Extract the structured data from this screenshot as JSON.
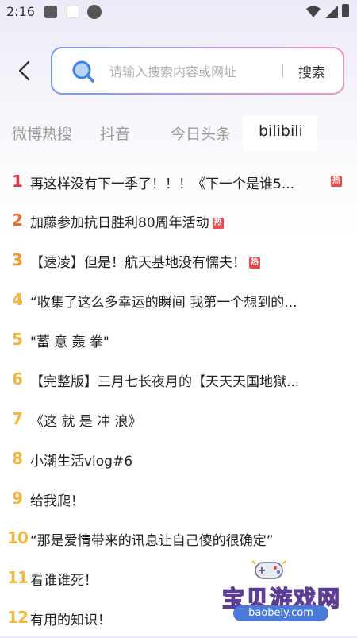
{
  "status_bar": {
    "time": "2:16"
  },
  "header": {
    "search_placeholder": "请输入搜索内容或网址",
    "search_button": "搜索"
  },
  "tabs": [
    {
      "label": "微博热搜",
      "active": false
    },
    {
      "label": "抖音",
      "active": false
    },
    {
      "label": "今日头条",
      "active": false
    },
    {
      "label": "bilibili",
      "active": true
    }
  ],
  "hot_list": [
    {
      "rank": "1",
      "title": "再这样没有下一季了！！！《下一个是谁5...",
      "badge": "热",
      "rank_color": "#e0393e"
    },
    {
      "rank": "2",
      "title": "加藤参加抗日胜利80周年活动",
      "badge": "热",
      "rank_color": "#ee6a2f"
    },
    {
      "rank": "3",
      "title": "【速凌】但是！航天基地没有懦夫！",
      "badge": "热",
      "rank_color": "#f09a2b"
    },
    {
      "rank": "4",
      "title": "“收集了这么多幸运的瞬间 我第一个想到的...",
      "badge": "",
      "rank_color": "#f4b63a"
    },
    {
      "rank": "5",
      "title": "\"蓄 意 轰 拳\"",
      "badge": "",
      "rank_color": "#f4b63a"
    },
    {
      "rank": "6",
      "title": "【完整版】三月七长夜月的【天天天国地獄...",
      "badge": "",
      "rank_color": "#f4b63a"
    },
    {
      "rank": "7",
      "title": "《这 就 是 冲 浪》",
      "badge": "",
      "rank_color": "#f4b63a"
    },
    {
      "rank": "8",
      "title": "小潮生活vlog#6",
      "badge": "",
      "rank_color": "#f4b63a"
    },
    {
      "rank": "9",
      "title": "给我爬！",
      "badge": "",
      "rank_color": "#f4b63a"
    },
    {
      "rank": "10",
      "title": "“那是爱情带来的讯息让自己傻的很确定”",
      "badge": "",
      "rank_color": "#f4b63a"
    },
    {
      "rank": "11",
      "title": "看谁谁死！",
      "badge": "",
      "rank_color": "#f4b63a"
    },
    {
      "rank": "12",
      "title": "有用的知识！",
      "badge": "",
      "rank_color": "#f4b63a"
    }
  ],
  "watermark": {
    "name": "宝贝游戏网",
    "url": "baobeiy.com"
  },
  "colors": {
    "hot_badge": "#e84a4a",
    "search_gradient_start": "#6f9ef0",
    "search_gradient_end": "#f096c4"
  }
}
